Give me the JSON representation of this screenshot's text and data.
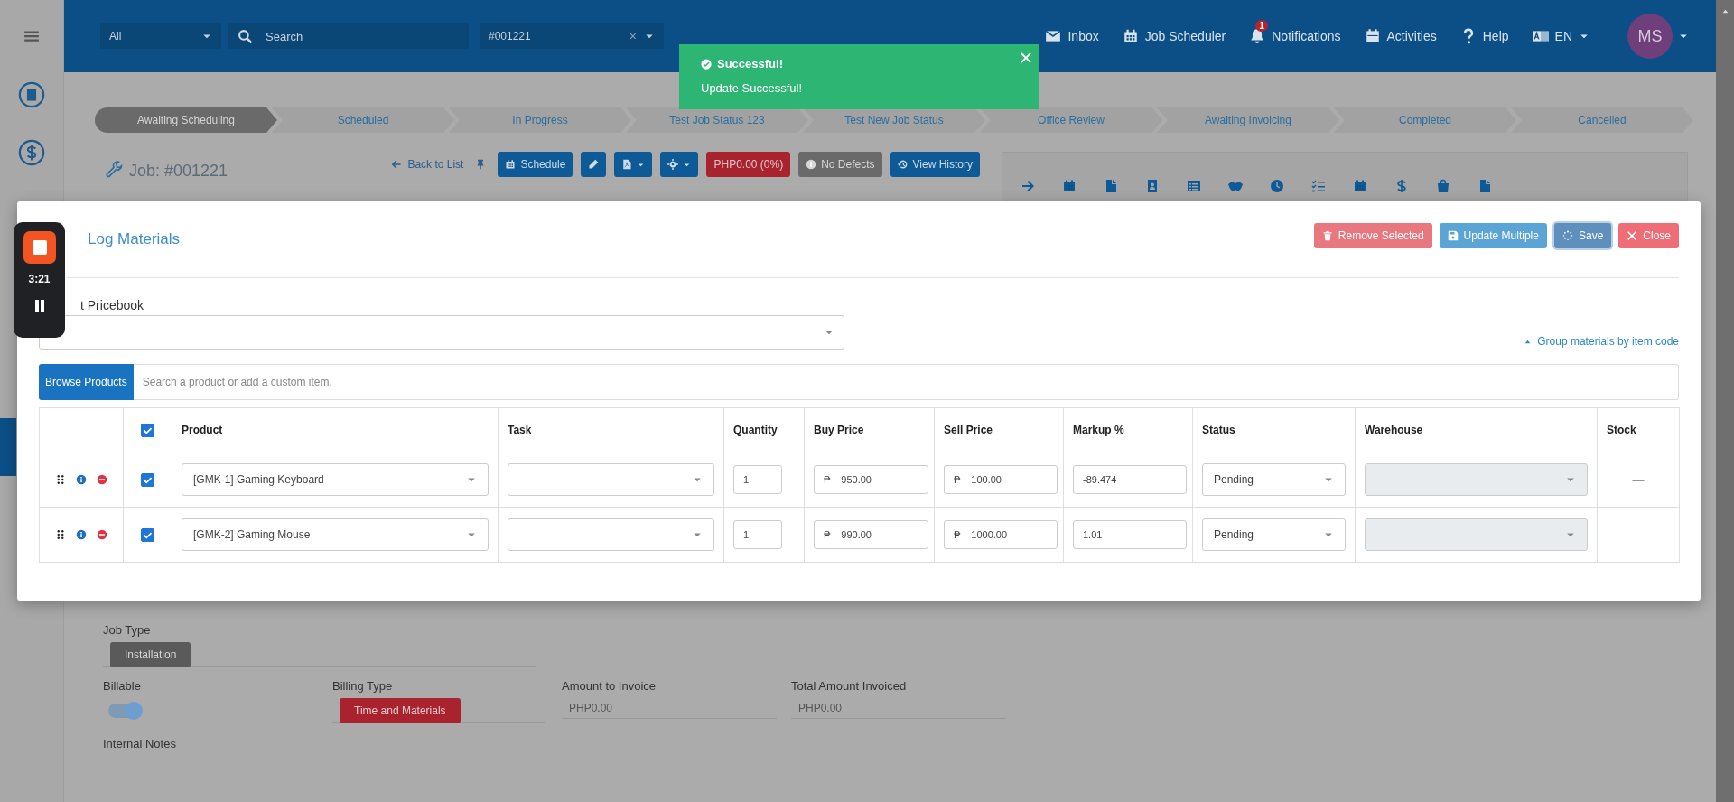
{
  "topbar": {
    "scope": "All",
    "search_placeholder": "Search",
    "job": "#001221",
    "clear": "×",
    "nav": [
      {
        "label": "Inbox"
      },
      {
        "label": "Job Scheduler"
      },
      {
        "label": "Notifications",
        "badge": "1"
      },
      {
        "label": "Activities"
      },
      {
        "label": "Help"
      },
      {
        "label": "EN"
      }
    ],
    "avatar": "MS"
  },
  "toast": {
    "title": "Successful!",
    "message": "Update Successful!"
  },
  "pipeline": [
    {
      "label": "Awaiting Scheduling",
      "selected": true
    },
    {
      "label": "Scheduled",
      "selected": false
    },
    {
      "label": "In Progress",
      "selected": false
    },
    {
      "label": "Test Job Status 123",
      "selected": false
    },
    {
      "label": "Test New Job Status",
      "selected": false
    },
    {
      "label": "Office Review",
      "selected": false
    },
    {
      "label": "Awaiting Invoicing",
      "selected": false
    },
    {
      "label": "Completed",
      "selected": false
    },
    {
      "label": "Cancelled",
      "selected": false
    }
  ],
  "job": {
    "title": "Job: #001221",
    "back": "Back to List",
    "schedule": "Schedule",
    "amount": "PHP0.00 (0%)",
    "defects": "No Defects",
    "history": "View History"
  },
  "modal": {
    "title": "Log Materials",
    "buttons": [
      {
        "label": "Remove Selected",
        "kind": "remove"
      },
      {
        "label": "Update Multiple",
        "kind": "update"
      },
      {
        "label": "Save",
        "kind": "save"
      },
      {
        "label": "Close",
        "kind": "close"
      }
    ],
    "pricebook_label": "t Pricebook",
    "group_link": "Group materials by item code",
    "browse": "Browse Products",
    "search_placeholder": "Search a product or add a custom item.",
    "table": {
      "columns": [
        "Product",
        "Task",
        "Quantity",
        "Buy Price",
        "Sell Price",
        "Markup %",
        "Status",
        "Warehouse",
        "Stock"
      ],
      "all_checked": true,
      "rows": [
        {
          "checked": true,
          "product": "[GMK-1] Gaming Keyboard",
          "quantity": "1",
          "currency": "₱",
          "buy_price": "950.00",
          "sell_price": "100.00",
          "markup": "-89.474",
          "status": "Pending",
          "stock": "—"
        },
        {
          "checked": true,
          "product": "[GMK-2] Gaming Mouse",
          "quantity": "1",
          "currency": "₱",
          "buy_price": "990.00",
          "sell_price": "1000.00",
          "markup": "1.01",
          "status": "Pending",
          "stock": "—"
        }
      ]
    }
  },
  "recorder": {
    "time": "3:21"
  },
  "details": {
    "job_type_label": "Job Type",
    "job_type": "Installation",
    "billable_label": "Billable",
    "billable": true,
    "billing_type_label": "Billing Type",
    "billing_type": "Time and Materials",
    "amount_label": "Amount to Invoice",
    "amount": "PHP0.00",
    "total_label": "Total Amount Invoiced",
    "total": "PHP0.00",
    "notes_label": "Internal Notes"
  }
}
